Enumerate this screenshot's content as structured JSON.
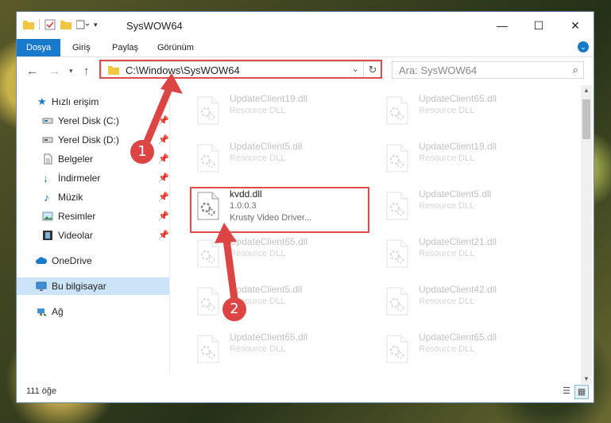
{
  "window": {
    "title": "SysWOW64"
  },
  "ribbon": {
    "tabs": [
      "Dosya",
      "Giriş",
      "Paylaş",
      "Görünüm"
    ]
  },
  "address": {
    "path": "C:\\Windows\\SysWOW64"
  },
  "search": {
    "placeholder": "Ara: SysWOW64"
  },
  "sidebar": {
    "items": [
      {
        "label": "Hızlı erişim"
      },
      {
        "label": "Yerel Disk (C:)"
      },
      {
        "label": "Yerel Disk (D:)"
      },
      {
        "label": "Belgeler"
      },
      {
        "label": "İndirmeler"
      },
      {
        "label": "Müzik"
      },
      {
        "label": "Resimler"
      },
      {
        "label": "Videolar"
      },
      {
        "label": "OneDrive"
      },
      {
        "label": "Bu bilgisayar"
      },
      {
        "label": "Ağ"
      }
    ]
  },
  "files": {
    "left": [
      {
        "name": "UpdateClient19.dll",
        "type": "Resource DLL"
      },
      {
        "name": "UpdateClient5.dll",
        "type": "Resource DLL"
      },
      {
        "name": "kvdd.dll",
        "version": "1.0.0.3",
        "desc": "Krusty Video Driver..."
      },
      {
        "name": "UpdateClient65.dll",
        "type": "Resource DLL"
      },
      {
        "name": "UpdateClient5.dll",
        "type": "Resource DLL"
      },
      {
        "name": "UpdateClient65.dll",
        "type": "Resource DLL"
      }
    ],
    "right": [
      {
        "name": "UpdateClient65.dll",
        "type": "Resource DLL"
      },
      {
        "name": "UpdateClient19.dll",
        "type": "Resource DLL"
      },
      {
        "name": "UpdateClient5.dll",
        "type": "Resource DLL"
      },
      {
        "name": "UpdateClient21.dll",
        "type": "Resource DLL"
      },
      {
        "name": "UpdateClient42.dll",
        "type": "Resource DLL"
      },
      {
        "name": "UpdateClient65.dll",
        "type": "Resource DLL"
      }
    ]
  },
  "status": {
    "count": "111 öğe"
  },
  "annotations": {
    "badge1": "1",
    "badge2": "2"
  },
  "colors": {
    "accent": "#1979ca",
    "highlight": "#e14b4b",
    "selected": "#cce4f7"
  }
}
